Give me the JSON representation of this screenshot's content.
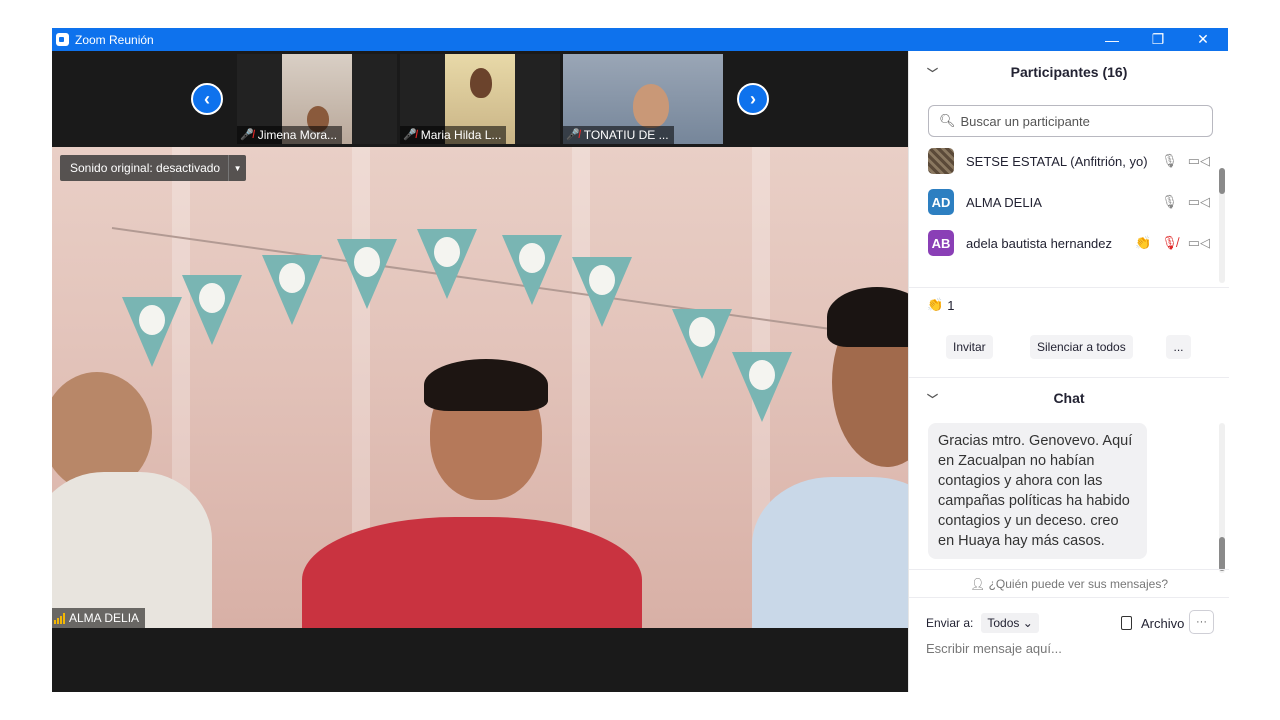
{
  "window": {
    "title": "Zoom Reunión",
    "controls": {
      "minimize": "—",
      "restore": "❐",
      "close": "✕"
    }
  },
  "thumbnails": [
    {
      "name": "Jimena Mora..."
    },
    {
      "name": "Maria Hilda L..."
    },
    {
      "name": "TONATIU DE ..."
    }
  ],
  "nav": {
    "prev": "‹",
    "next": "›"
  },
  "main_video": {
    "sound_toggle": "Sonido original: desactivado",
    "speaker": "ALMA DELIA"
  },
  "participants": {
    "title": "Participantes (16)",
    "search_placeholder": "Buscar un participante",
    "items": [
      {
        "name": "SETSE ESTATAL (Anfitrión, yo)",
        "initials": "",
        "color": "#6a5a48"
      },
      {
        "name": "ALMA DELIA",
        "initials": "AD",
        "color": "#2d7fc1"
      },
      {
        "name": "adela bautista hernandez",
        "initials": "AB",
        "color": "#8a3fb6"
      }
    ],
    "clap_count": "1",
    "buttons": {
      "invite": "Invitar",
      "mute_all": "Silenciar a todos",
      "more": "..."
    }
  },
  "chat": {
    "title": "Chat",
    "message": "Gracias mtro. Genovevo. Aquí en Zacualpan no habían contagios y ahora con las campañas políticas ha habido contagios y un deceso. creo en Huaya hay más casos.",
    "who_can_see": "¿Quién puede ver sus mensajes?",
    "send_to_label": "Enviar a:",
    "send_to_value": "Todos",
    "file_label": "Archivo",
    "more": "···",
    "input_placeholder": "Escribir mensaje aquí..."
  },
  "colors": {
    "accent": "#0e72ed",
    "mute": "#e02828"
  }
}
